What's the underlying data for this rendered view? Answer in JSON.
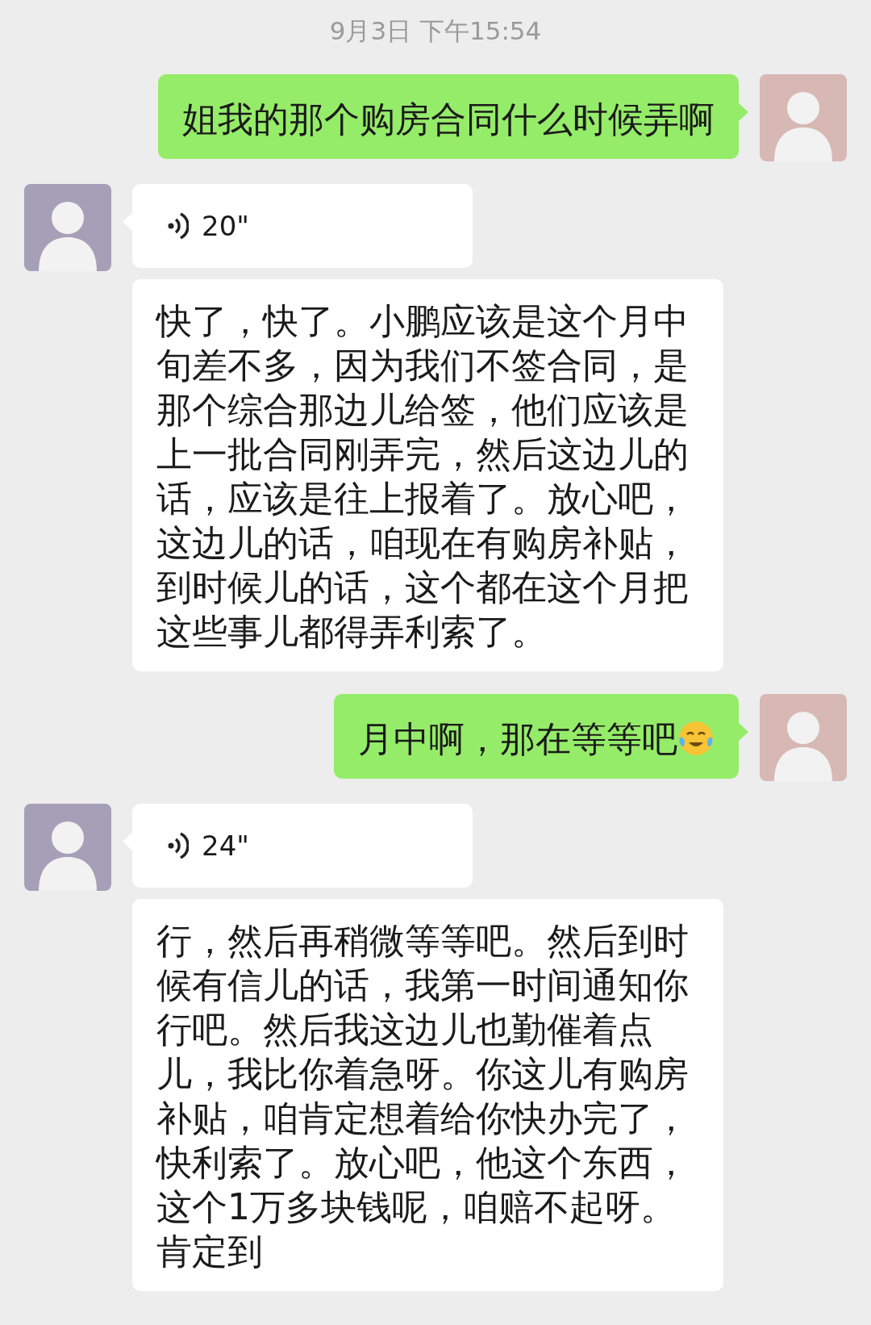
{
  "timestamp": "9月3日 下午15:54",
  "groups": [
    {
      "outgoing": true,
      "messages": [
        {
          "kind": "text",
          "text": "姐我的那个购房合同什么时候弄啊",
          "emoji": false
        }
      ]
    },
    {
      "outgoing": false,
      "messages": [
        {
          "kind": "voice",
          "duration": "20\""
        },
        {
          "kind": "text",
          "text": "快了，快了。小鹏应该是这个月中旬差不多，因为我们不签合同，是那个综合那边儿给签，他们应该是上一批合同刚弄完，然后这边儿的话，应该是往上报着了。放心吧，这边儿的话，咱现在有购房补贴，到时候儿的话，这个都在这个月把这些事儿都得弄利索了。",
          "emoji": false
        }
      ]
    },
    {
      "outgoing": true,
      "messages": [
        {
          "kind": "text",
          "text": "月中啊，那在等等吧",
          "emoji": true
        }
      ]
    },
    {
      "outgoing": false,
      "messages": [
        {
          "kind": "voice",
          "duration": "24\""
        },
        {
          "kind": "text",
          "text": "行，然后再稍微等等吧。然后到时候有信儿的话，我第一时间通知你行吧。然后我这边儿也勤催着点儿，我比你着急呀。你这儿有购房补贴，咱肯定想着给你快办完了，快利索了。放心吧，他这个东西，这个1万多块钱呢，咱赔不起呀。肯定到",
          "emoji": false
        }
      ]
    }
  ]
}
